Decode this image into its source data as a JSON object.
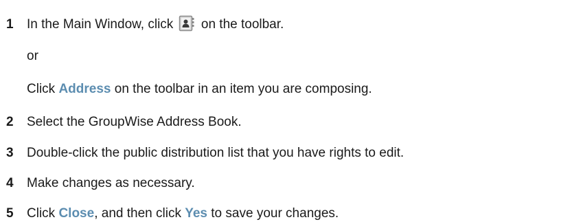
{
  "steps": [
    {
      "number": "1",
      "text_before_icon": "In the Main Window, click",
      "icon": "address-book-toolbar-icon",
      "text_after_icon": "on the toolbar.",
      "or": "or",
      "alt_text_before": "Click",
      "alt_ui_term": "Address",
      "alt_text_after": "on the toolbar in an item you are composing."
    },
    {
      "number": "2",
      "text": "Select the GroupWise Address Book."
    },
    {
      "number": "3",
      "text": "Double-click the public distribution list that you have rights to edit."
    },
    {
      "number": "4",
      "text": "Make changes as necessary."
    },
    {
      "number": "5",
      "text_before": "Click",
      "ui_term_1": "Close",
      "text_middle": ", and then click",
      "ui_term_2": "Yes",
      "text_after": "to save your changes."
    }
  ],
  "colors": {
    "text": "#1a1a1a",
    "ui_term": "#5c8db0",
    "icon_frame": "#8a8a8a",
    "icon_figure": "#3a3a3a"
  }
}
